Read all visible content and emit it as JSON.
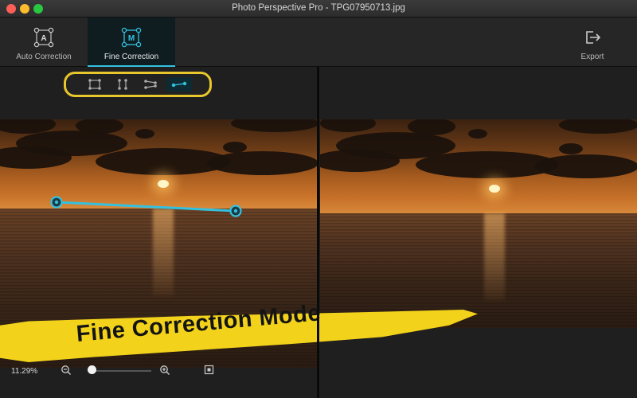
{
  "window": {
    "title": "Photo Perspective Pro - TPG07950713.jpg"
  },
  "toolbar": {
    "modes": [
      {
        "label": "Auto Correction",
        "icon": "auto-correction-icon",
        "active": false
      },
      {
        "label": "Fine Correction",
        "icon": "fine-correction-icon",
        "active": true
      }
    ],
    "export_label": "Export",
    "auto_glyph": "A",
    "fine_glyph": "M"
  },
  "tools": [
    {
      "icon": "rectangle-points-icon",
      "active": false
    },
    {
      "icon": "vertical-lines-icon",
      "active": false
    },
    {
      "icon": "horizontal-lines-icon",
      "active": false
    },
    {
      "icon": "horizon-line-icon",
      "active": true
    }
  ],
  "banner": {
    "text": "Fine Correction Mode"
  },
  "zoom": {
    "percent": "11.29%",
    "level": 0.02
  },
  "colors": {
    "accent": "#33c1e0",
    "highlight": "#e8c72c",
    "banner": "#f2d21a"
  }
}
